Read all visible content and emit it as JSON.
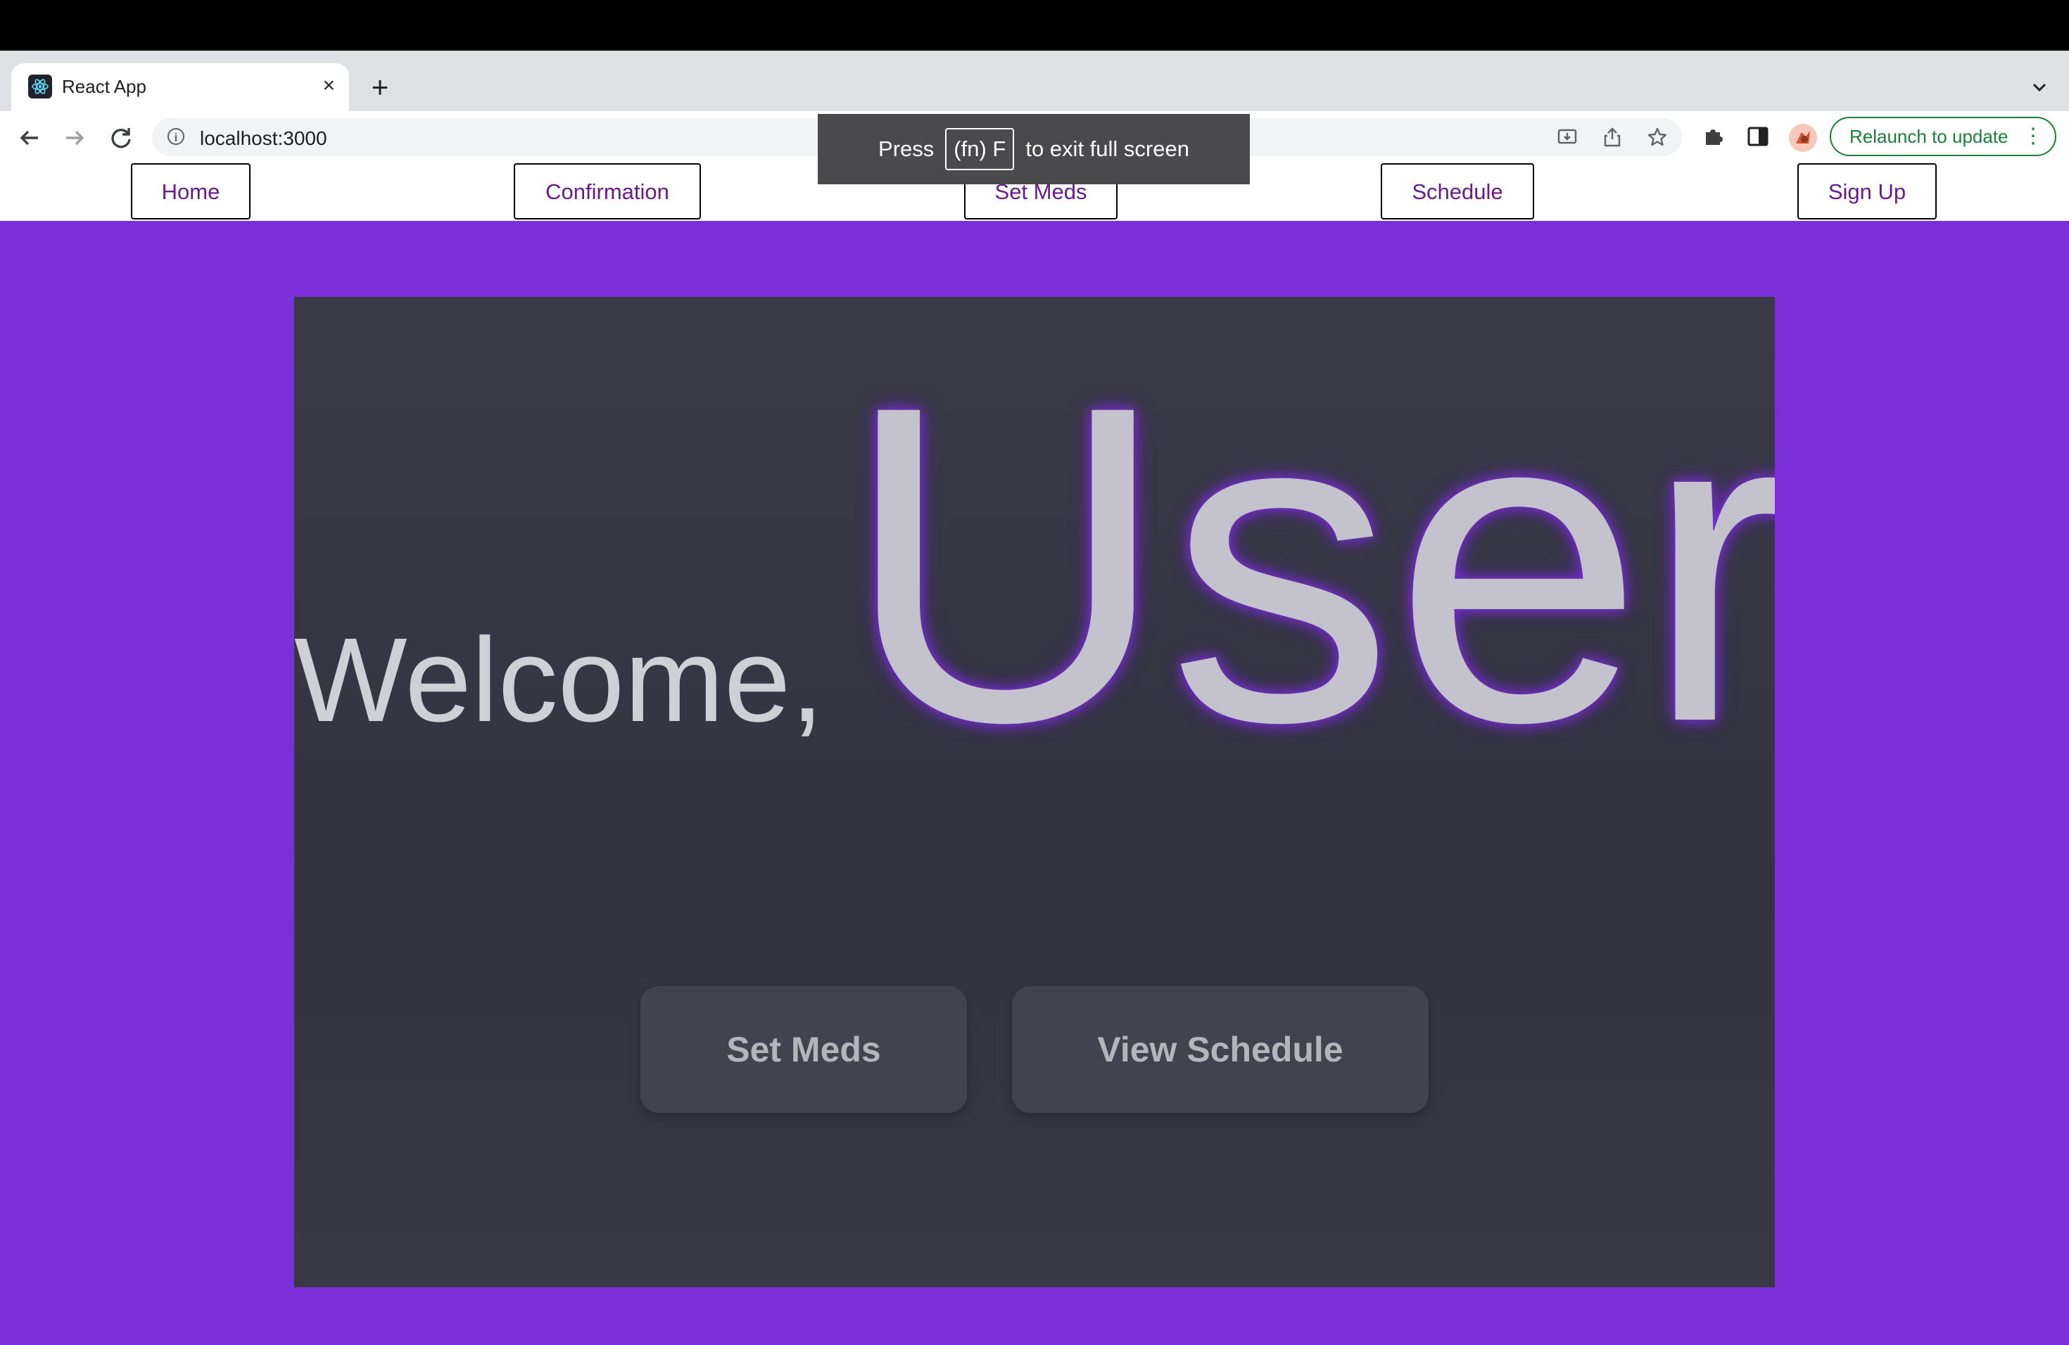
{
  "browser": {
    "tab": {
      "title": "React App",
      "close_glyph": "×"
    },
    "new_tab_glyph": "+",
    "omnibox": {
      "url": "localhost:3000"
    },
    "relaunch_label": "Relaunch to update",
    "icons": [
      "back-arrow-icon",
      "forward-arrow-icon",
      "reload-icon",
      "info-icon",
      "install-icon",
      "share-icon",
      "star-icon",
      "extensions-icon",
      "side-panel-icon",
      "profile-avatar",
      "more-vert-icon",
      "tab-search-chevron-icon"
    ]
  },
  "fullscreen_toast": {
    "press": "Press",
    "key": "(fn) F",
    "suffix": "to exit full screen"
  },
  "app_nav": {
    "items": [
      {
        "label": "Home"
      },
      {
        "label": "Confirmation"
      },
      {
        "label": "Set Meds"
      },
      {
        "label": "Schedule"
      },
      {
        "label": "Sign Up"
      }
    ]
  },
  "hero": {
    "welcome": "Welcome,",
    "user": "User",
    "buttons": [
      {
        "label": "Set Meds"
      },
      {
        "label": "View Schedule"
      }
    ]
  },
  "colors": {
    "page_background": "#7c30da",
    "card_background": "#363645",
    "nav_link": "#6a1a8a",
    "user_glow": "#7a32d4",
    "relaunch_green": "#188038"
  }
}
